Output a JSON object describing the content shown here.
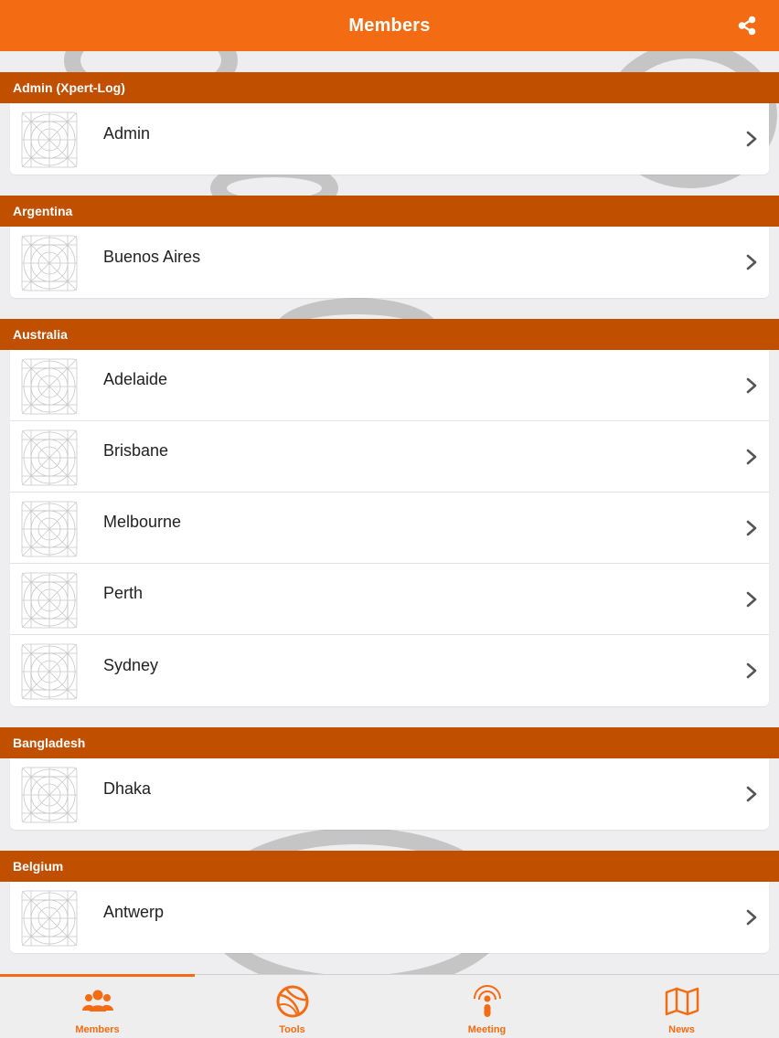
{
  "header": {
    "title": "Members",
    "share_icon": "share-icon"
  },
  "sections": [
    {
      "title": "Admin (Xpert-Log)",
      "items": [
        {
          "label": "Admin"
        }
      ]
    },
    {
      "title": "Argentina",
      "items": [
        {
          "label": "Buenos Aires"
        }
      ]
    },
    {
      "title": "Australia",
      "items": [
        {
          "label": "Adelaide"
        },
        {
          "label": "Brisbane"
        },
        {
          "label": "Melbourne"
        },
        {
          "label": "Perth"
        },
        {
          "label": "Sydney"
        }
      ]
    },
    {
      "title": "Bangladesh",
      "items": [
        {
          "label": "Dhaka"
        }
      ]
    },
    {
      "title": "Belgium",
      "items": [
        {
          "label": "Antwerp"
        }
      ]
    }
  ],
  "tabbar": {
    "tabs": [
      {
        "label": "Members",
        "icon": "members-icon",
        "active": true
      },
      {
        "label": "Tools",
        "icon": "basketball-icon",
        "active": false
      },
      {
        "label": "Meeting",
        "icon": "podcast-icon",
        "active": false
      },
      {
        "label": "News",
        "icon": "map-icon",
        "active": false
      }
    ]
  },
  "colors": {
    "accent": "#f36b12",
    "section_header": "#c05000"
  }
}
